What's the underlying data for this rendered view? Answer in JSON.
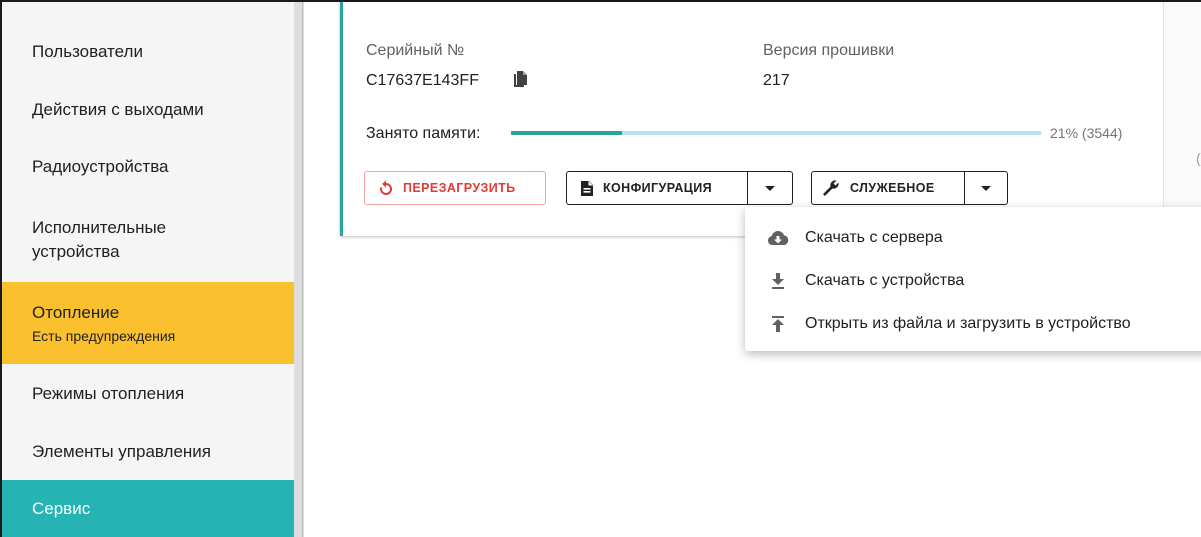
{
  "sidebar": {
    "items": [
      {
        "label": "Пользователи"
      },
      {
        "label": "Действия с выходами"
      },
      {
        "label": "Радиоустройства"
      },
      {
        "label": "Исполнительные",
        "label2": "устройства"
      },
      {
        "label": "Отопление",
        "sublabel": "Есть предупреждения",
        "status": "warning"
      },
      {
        "label": "Режимы отопления"
      },
      {
        "label": "Элементы управления"
      },
      {
        "label": "Сервис",
        "status": "active"
      }
    ]
  },
  "device": {
    "serial_label": "Серийный №",
    "serial_value": "C17637E143FF",
    "firmware_label": "Версия прошивки",
    "firmware_value": "217",
    "memory_label": "Занято памяти:",
    "memory_percent": 21,
    "memory_text": "21%  (3544)"
  },
  "buttons": {
    "restart_label": "ПЕРЕЗАГРУЗИТЬ",
    "config_label": "КОНФИГУРАЦИЯ",
    "service_label": "СЛУЖЕБНОЕ"
  },
  "menu": {
    "items": [
      {
        "label": "Скачать с сервера",
        "icon": "cloud-download-icon"
      },
      {
        "label": "Скачать с устройства",
        "icon": "download-icon"
      },
      {
        "label": "Открыть из файла и загрузить в устройство",
        "icon": "upload-icon"
      }
    ]
  },
  "edge_glyph": "(",
  "colors": {
    "accent": "#26b3b3",
    "warning": "#fbc02d",
    "danger": "#e53935",
    "progress": "#26a69a",
    "progress_track": "#b2e3ea"
  }
}
